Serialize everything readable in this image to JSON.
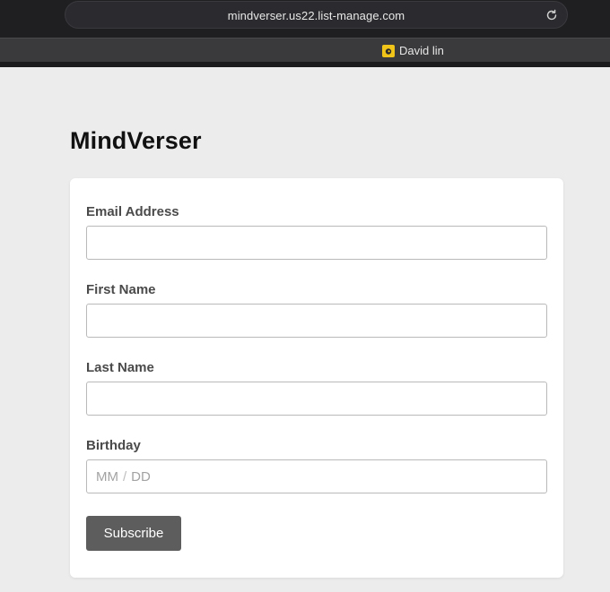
{
  "browser": {
    "url": "mindverser.us22.list-manage.com",
    "bookmarks": [
      {
        "label": "David lin",
        "icon": "mailchimp-icon"
      }
    ]
  },
  "page": {
    "brand": "MindVerser",
    "form": {
      "email": {
        "label": "Email Address",
        "value": "",
        "placeholder": ""
      },
      "first_name": {
        "label": "First Name",
        "value": "",
        "placeholder": ""
      },
      "last_name": {
        "label": "Last Name",
        "value": "",
        "placeholder": ""
      },
      "birthday": {
        "label": "Birthday",
        "month_placeholder": "MM",
        "separator": "/",
        "day_placeholder": "DD"
      },
      "submit_label": "Subscribe"
    }
  },
  "colors": {
    "page_background": "#ececec",
    "button_background": "#5d5d5d",
    "bookmark_icon": "#f0c419"
  }
}
